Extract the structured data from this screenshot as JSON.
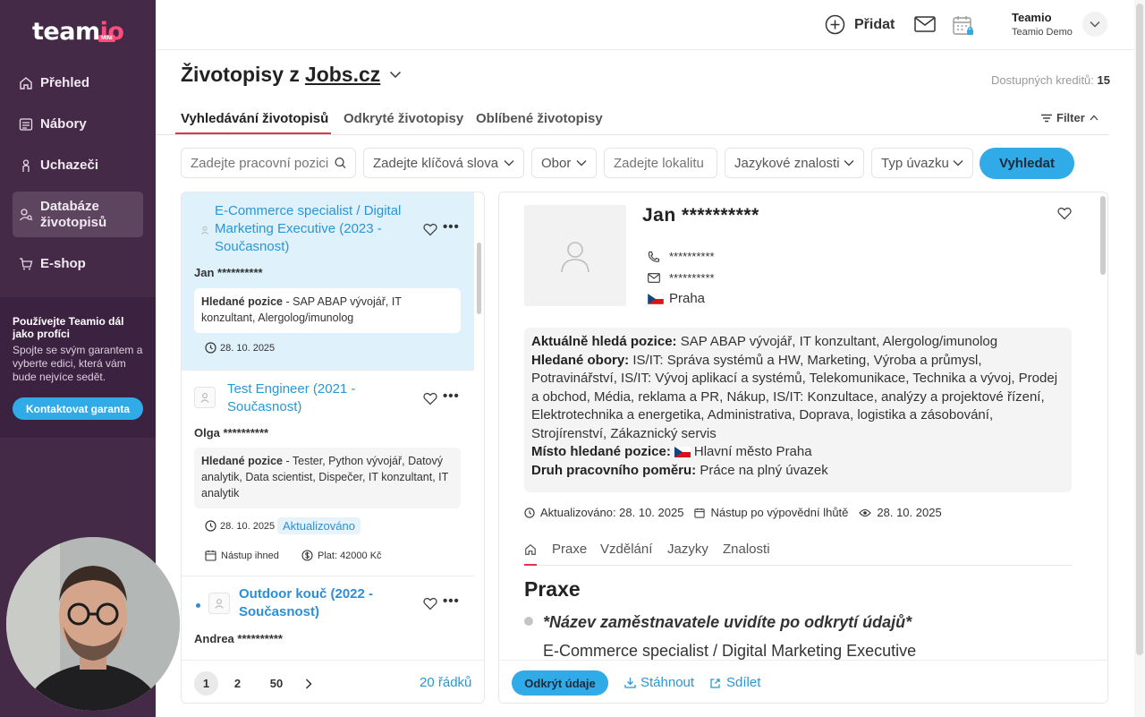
{
  "sidebar": {
    "logo": {
      "text": "team",
      "accent": "io",
      "badge": "MINI"
    },
    "items": [
      {
        "label": "Přehled",
        "icon": "home-icon"
      },
      {
        "label": "Nábory",
        "icon": "list-icon"
      },
      {
        "label": "Uchazeči",
        "icon": "person-icon"
      },
      {
        "label": "Databáze životopisů",
        "icon": "database-search-icon",
        "active": true
      },
      {
        "label": "E-shop",
        "icon": "cart-icon"
      }
    ],
    "promo": {
      "title": "Používejte Teamio dál jako profíci",
      "text": "Spojte se svým garantem a vyberte edici, která vám bude nejvíce sedět.",
      "button": "Kontaktovat garanta"
    }
  },
  "topbar": {
    "add_label": "Přidat",
    "user_name": "Teamio",
    "user_company": "Teamio Demo"
  },
  "page": {
    "title_prefix": "Životopisy z",
    "title_source": "Jobs.cz",
    "credits_label": "Dostupných kreditů:",
    "credits_value": "15"
  },
  "tabs": [
    "Vyhledávání životopisů",
    "Odkryté životopisy",
    "Oblíbené životopisy"
  ],
  "filter_label": "Filter",
  "search": {
    "position_placeholder": "Zadejte pracovní pozici",
    "keywords": "Zadejte klíčová slova",
    "field": "Obor",
    "location_placeholder": "Zadejte lokalitu",
    "languages": "Jazykové znalosti",
    "employment_type": "Typ úvazku",
    "button": "Vyhledat"
  },
  "results": [
    {
      "title": "E-Commerce specialist / Digital Marketing Executive (2023 - Současnost)",
      "name": "Jan **********",
      "wanted_label": "Hledané pozice",
      "wanted": " - SAP ABAP vývojář, IT konzultant, Alergolog/imunolog",
      "date": "28. 10. 2025"
    },
    {
      "title": "Test Engineer (2021 - Současnost)",
      "name": "Olga **********",
      "wanted_label": "Hledané pozice",
      "wanted": " - Tester, Python vývojář, Datový analytik, Data scientist, Dispečer, IT konzultant, IT analytik",
      "date": "28. 10. 2025",
      "badge": "Aktualizováno",
      "start": "Nástup ihned",
      "salary": "Plat: 42000 Kč"
    },
    {
      "title": "Outdoor kouč (2022 - Současnost)",
      "name": "Andrea **********"
    }
  ],
  "pager": {
    "pages": [
      "1",
      "2",
      "50"
    ],
    "rows": "20 řádků"
  },
  "detail": {
    "name": "Jan **********",
    "phone": "**********",
    "email": "**********",
    "city": "Praha",
    "current_label": "Aktuálně hledá pozice:",
    "current_value": "SAP ABAP vývojář, IT konzultant, Alergolog/imunolog",
    "fields_label": "Hledané obory:",
    "fields_value": "IS/IT: Správa systémů a HW, Marketing, Výroba a průmysl, Potravinářství, IS/IT: Vývoj aplikací a systémů, Telekomunikace, Technika a vývoj, Prodej a obchod, Média, reklama a PR, Nákup, IS/IT: Konzultace, analýzy a projektové řízení, Elektrotechnika a energetika, Administrativa, Doprava, logistika a zásobování, Strojírenství, Zákaznický servis",
    "place_label": "Místo hledané pozice:",
    "place_value": "Hlavní město Praha",
    "type_label": "Druh pracovního poměru:",
    "type_value": "Práce na plný úvazek",
    "updated": "Aktualizováno: 28. 10. 2025",
    "start": "Nástup po výpovědní lhůtě",
    "viewed": "28. 10. 2025",
    "tabs": [
      "Praxe",
      "Vzdělání",
      "Jazyky",
      "Znalosti"
    ],
    "section_title": "Praxe",
    "employer": "*Název zaměstnavatele uvidíte po odkrytí údajů*",
    "job_title": "E-Commerce specialist / Digital Marketing Executive",
    "reveal_button": "Odkrýt údaje",
    "download": "Stáhnout",
    "share": "Sdílet"
  },
  "colors": {
    "sidebar": "#452a48",
    "accent": "#31aae8",
    "link": "#2a96d5",
    "tab_underline": "#e0334d",
    "brand_pink": "#ff4d7d"
  }
}
